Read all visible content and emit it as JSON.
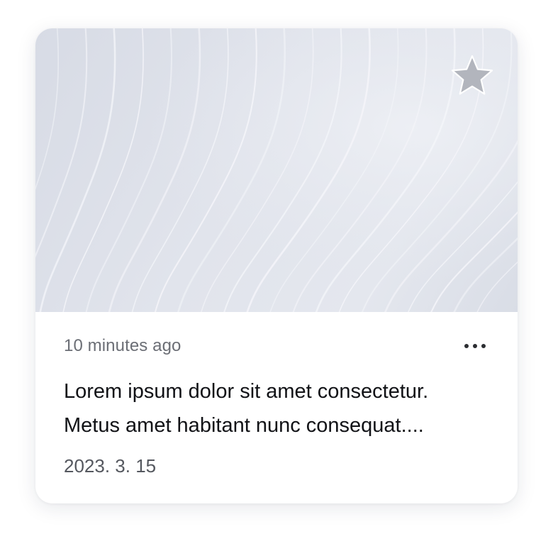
{
  "card": {
    "favorite_active": false,
    "timestamp": "10 minutes ago",
    "title_line1": "Lorem ipsum dolor sit amet consectetur.",
    "title_line2": "Metus amet habitant nunc consequat....",
    "date": "2023. 3. 15",
    "icons": {
      "favorite": "star-icon",
      "menu": "more-horizontal-icon"
    }
  },
  "colors": {
    "star_fill": "#b2b5bd",
    "thumb_base": "#dde0e8",
    "title_text": "#111216",
    "meta_text": "#6b6e75"
  }
}
